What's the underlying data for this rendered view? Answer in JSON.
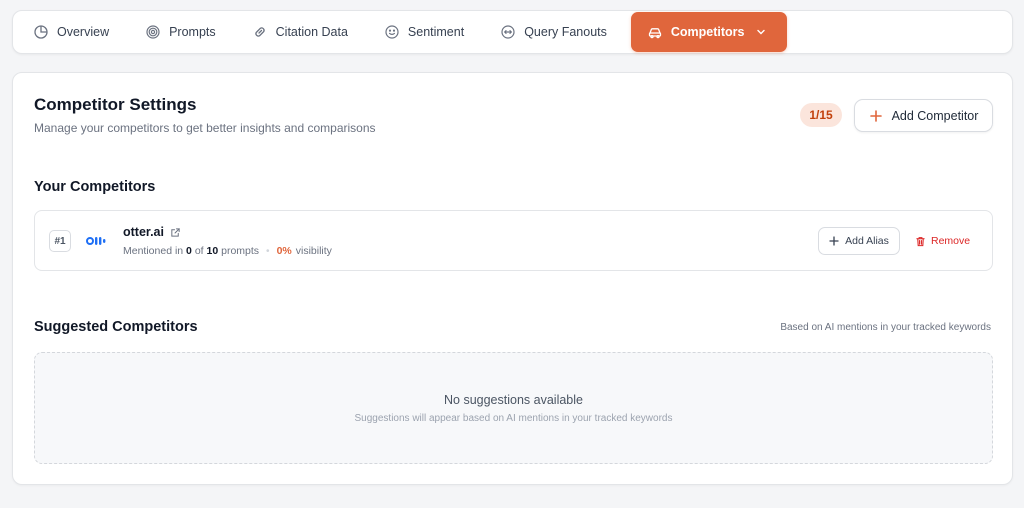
{
  "tabs": [
    {
      "label": "Overview",
      "icon": "pie-chart-icon"
    },
    {
      "label": "Prompts",
      "icon": "target-icon"
    },
    {
      "label": "Citation Data",
      "icon": "link-icon"
    },
    {
      "label": "Sentiment",
      "icon": "smile-icon"
    },
    {
      "label": "Query Fanouts",
      "icon": "fanout-icon"
    },
    {
      "label": "Competitors",
      "icon": "car-icon",
      "active": true
    }
  ],
  "settings": {
    "title": "Competitor Settings",
    "subtitle": "Manage your competitors to get better insights and comparisons",
    "count": "1/15",
    "add_label": "Add Competitor"
  },
  "your_competitors": {
    "title": "Your Competitors",
    "items": [
      {
        "rank": "#1",
        "name": "otter.ai",
        "mentioned_prefix": "Mentioned in",
        "mentioned": "0",
        "of": "of",
        "total": "10",
        "prompts_word": "prompts",
        "visibility_pct": "0%",
        "visibility_word": "visibility",
        "alias_label": "Add Alias",
        "remove_label": "Remove"
      }
    ]
  },
  "suggested": {
    "title": "Suggested Competitors",
    "note": "Based on AI mentions in your tracked keywords",
    "empty_title": "No suggestions available",
    "empty_sub": "Suggestions will appear based on AI mentions in your tracked keywords"
  },
  "colors": {
    "accent": "#e0663c",
    "danger": "#dc2626",
    "brand_logo": "#1e6ff5"
  }
}
